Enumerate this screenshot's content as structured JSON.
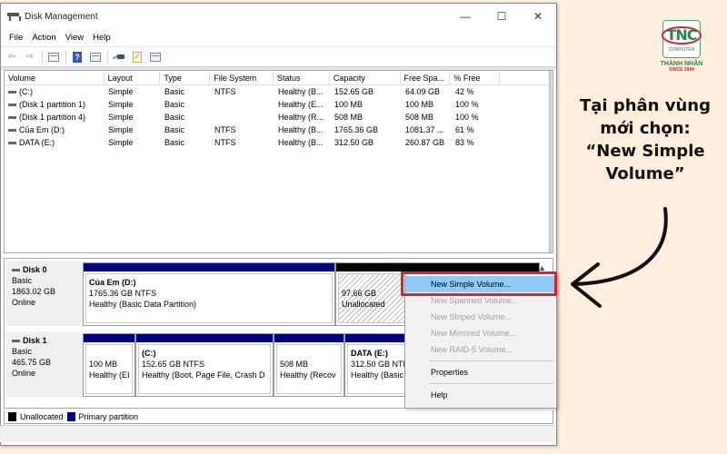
{
  "window": {
    "title": "Disk Management",
    "controls": {
      "minimize": "—",
      "maximize": "☐",
      "close": "✕"
    }
  },
  "menu": [
    "File",
    "Action",
    "View",
    "Help"
  ],
  "toolbar": {
    "icons": [
      "back-arrow-icon",
      "forward-arrow-icon",
      "console-tree-icon",
      "help-icon",
      "properties-icon",
      "key-icon",
      "checklist-icon",
      "settings-panel-icon"
    ],
    "back": "⇦",
    "forward": "⇨",
    "help": "?",
    "check": "✓"
  },
  "volume_list": {
    "columns": [
      "Volume",
      "Layout",
      "Type",
      "File System",
      "Status",
      "Capacity",
      "Free Spa...",
      "% Free"
    ],
    "rows": [
      {
        "volume": "(C:)",
        "layout": "Simple",
        "type": "Basic",
        "fs": "NTFS",
        "status": "Healthy (B...",
        "capacity": "152.65 GB",
        "free": "64.09 GB",
        "pct": "42 %"
      },
      {
        "volume": "(Disk 1 partition 1)",
        "layout": "Simple",
        "type": "Basic",
        "fs": "",
        "status": "Healthy (E...",
        "capacity": "100 MB",
        "free": "100 MB",
        "pct": "100 %"
      },
      {
        "volume": "(Disk 1 partition 4)",
        "layout": "Simple",
        "type": "Basic",
        "fs": "",
        "status": "Healthy (R...",
        "capacity": "508 MB",
        "free": "508 MB",
        "pct": "100 %"
      },
      {
        "volume": "Của Em (D:)",
        "layout": "Simple",
        "type": "Basic",
        "fs": "NTFS",
        "status": "Healthy (B...",
        "capacity": "1765.36 GB",
        "free": "1081.37 ...",
        "pct": "61 %"
      },
      {
        "volume": "DATA (E:)",
        "layout": "Simple",
        "type": "Basic",
        "fs": "NTFS",
        "status": "Healthy (B...",
        "capacity": "312.50 GB",
        "free": "260.87 GB",
        "pct": "83 %"
      }
    ]
  },
  "disks": [
    {
      "name": "Disk 0",
      "type": "Basic",
      "size": "1863.02 GB",
      "status": "Online",
      "partitions": [
        {
          "name": "Của Em  (D:)",
          "size": "1765.36 GB NTFS",
          "status": "Healthy (Basic Data Partition)",
          "kind": "primary"
        },
        {
          "name": "",
          "size": "97.66 GB",
          "status": "Unallocated",
          "kind": "unallocated"
        }
      ]
    },
    {
      "name": "Disk 1",
      "type": "Basic",
      "size": "465.75 GB",
      "status": "Online",
      "partitions": [
        {
          "name": "",
          "size": "100 MB",
          "status": "Healthy (EI",
          "kind": "primary"
        },
        {
          "name": "(C:)",
          "size": "152.65 GB NTFS",
          "status": "Healthy (Boot, Page File, Crash D",
          "kind": "primary"
        },
        {
          "name": "",
          "size": "508 MB",
          "status": "Healthy (Recov",
          "kind": "primary"
        },
        {
          "name": "DATA  (E:)",
          "size": "312.50 GB NTF",
          "status": "Healthy (Basic",
          "kind": "primary"
        }
      ]
    }
  ],
  "legend": [
    {
      "label": "Unallocated",
      "color": "#000000"
    },
    {
      "label": "Primary partition",
      "color": "#000080"
    }
  ],
  "context_menu": {
    "items": [
      {
        "label": "New Simple Volume...",
        "state": "active"
      },
      {
        "label": "New Spanned Volume...",
        "state": "disabled"
      },
      {
        "label": "New Striped Volume...",
        "state": "disabled"
      },
      {
        "label": "New Mirrored Volume...",
        "state": "disabled"
      },
      {
        "label": "New RAID-5 Volume...",
        "state": "disabled"
      }
    ],
    "properties": "Properties",
    "help": "Help"
  },
  "annotation": {
    "caption_lines": [
      "Tại phân vùng",
      "mới chọn:",
      "“New Simple",
      "Volume”"
    ],
    "highlight_color": "#d9232d"
  },
  "logo": {
    "mark": "TNC",
    "sub": "COMPUTER",
    "name": "THÀNH NHÂN",
    "since": "SINCE 1994"
  }
}
